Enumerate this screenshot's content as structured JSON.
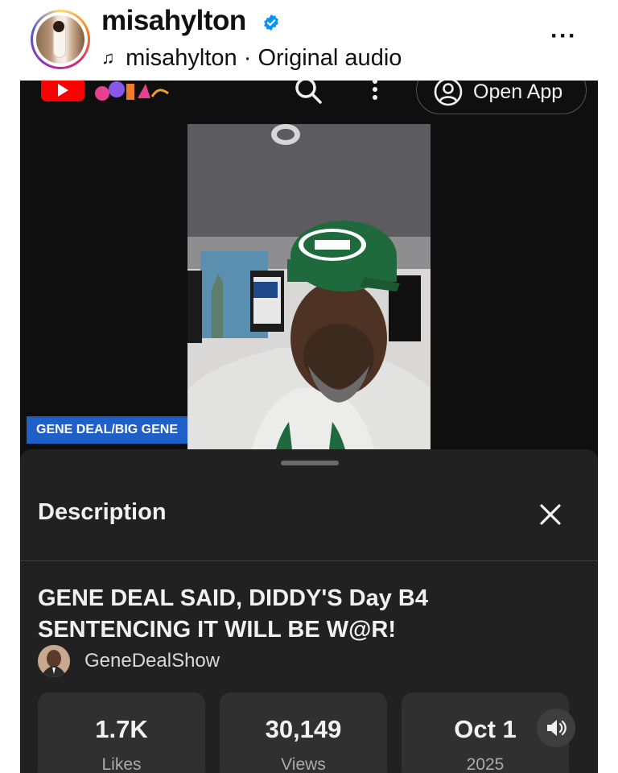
{
  "post_header": {
    "username": "misahylton",
    "audio_text": "misahylton · Original audio",
    "more_label": "···"
  },
  "youtube": {
    "open_app_label": "Open App",
    "video_caption": "GENE DEAL/BIG GENE",
    "description_sheet": {
      "heading": "Description",
      "close_label": "✕",
      "video_title": "GENE DEAL SAID, DIDDY'S Day B4 SENTENCING IT WILL BE W@R!",
      "channel_name": "GeneDealShow",
      "stats": [
        {
          "value": "1.7K",
          "label": "Likes"
        },
        {
          "value": "30,149",
          "label": "Views"
        },
        {
          "value": "Oct 1",
          "label": "2025"
        }
      ]
    }
  },
  "colors": {
    "verified_blue": "#0095f6",
    "youtube_red": "#ff0000",
    "caption_blue": "#1f5fc8",
    "jets_green": "#1e6a3c"
  }
}
